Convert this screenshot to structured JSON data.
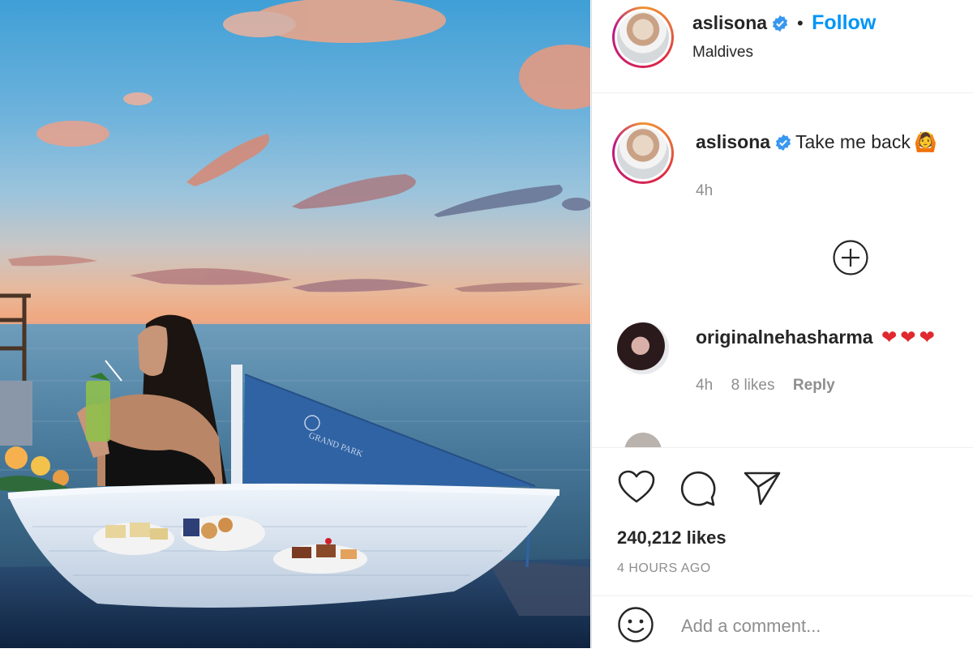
{
  "post": {
    "username": "aslisona",
    "verified": true,
    "follow_label": "Follow",
    "separator": "•",
    "location": "Maldives",
    "caption": "Take me back",
    "caption_emoji": "🙆",
    "caption_time": "4h"
  },
  "comments": [
    {
      "username": "originalnehasharma",
      "text": "❤❤❤",
      "time": "4h",
      "likes": "8 likes",
      "reply_label": "Reply"
    }
  ],
  "load_more_icon": "plus-circle-icon",
  "engagement": {
    "likes": "240,212 likes",
    "time_ago": "4 HOURS AGO"
  },
  "add_comment": {
    "placeholder": "Add a comment..."
  },
  "colors": {
    "link_blue": "#0095f6",
    "verified_blue": "#3897f0",
    "heart_red": "#e0282e",
    "text": "#262626",
    "muted": "#8e8e8e"
  }
}
